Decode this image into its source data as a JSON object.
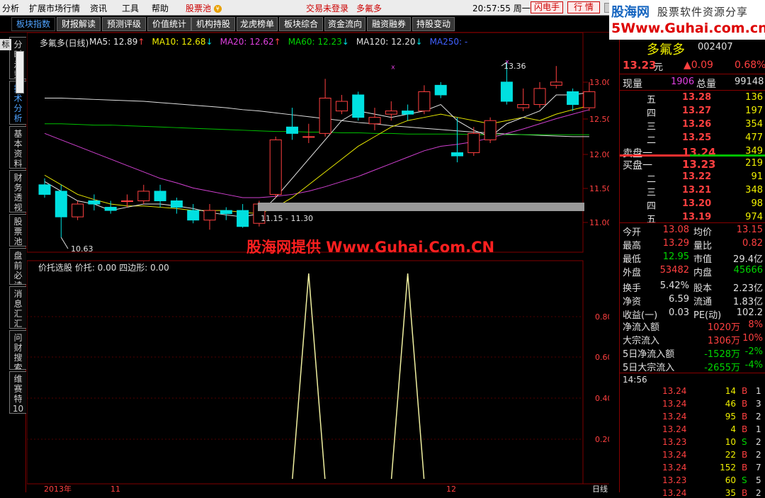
{
  "menu": {
    "items": [
      "分析",
      "扩展市场行情",
      "资讯",
      "工具",
      "帮助"
    ],
    "stock_pool": "股票池",
    "status": "交易未登录",
    "stock_name": "多氟多",
    "clock": "20:57:55 周一",
    "flash": "闪电手",
    "quote": "行  情",
    "pause": "∥"
  },
  "logo": {
    "a": "股海网",
    "b": "股票软件资源分享",
    "c": "5Www.Guhai.com.cn"
  },
  "tabs": [
    "板块指数",
    "财报解读",
    "预测评级",
    "价值统计",
    "机构持股",
    "龙虎榜单",
    "板块综合",
    "资金流向",
    "融资融券",
    "持股变动"
  ],
  "side_tag": "标",
  "side_tabs": [
    "分时走势",
    "技术分析",
    "基本资料",
    "财务透视",
    "股票池",
    "盘前必读",
    "消息汇汇",
    "问财搜索",
    "维赛特10"
  ],
  "chart": {
    "title": "多氟多(日线)",
    "ma": [
      {
        "label": "MA5: 12.89",
        "arrow": "↑",
        "color": "#e8e8e8",
        "acolor": "#ff4040"
      },
      {
        "label": "MA10: 12.68",
        "arrow": "↓",
        "color": "#f0f000",
        "acolor": "#00e0e0"
      },
      {
        "label": "MA20: 12.62",
        "arrow": "↑",
        "color": "#e040e0",
        "acolor": "#ff4040"
      },
      {
        "label": "MA60: 12.23",
        "arrow": "↓",
        "color": "#00d600",
        "acolor": "#00e0e0"
      },
      {
        "label": "MA120: 12.20",
        "arrow": "↓",
        "color": "#e0e0e0",
        "acolor": "#00e0e0"
      },
      {
        "label": "MA250: -",
        "arrow": "",
        "color": "#4060ff",
        "acolor": "#4060ff"
      }
    ],
    "high_label": "13.36",
    "low_label": "10.63",
    "range_label": "11.15 - 11.30",
    "watermark": "股海网提供 Www.Guhai.Com.CN",
    "ind_title": "价托选股  价托: 0.00  四边形: 0.00",
    "date_labels": [
      "2013年",
      "11",
      "12"
    ],
    "period": "日线",
    "price_ticks": [
      "13.00",
      "12.50",
      "12.00",
      "11.50",
      "11.00"
    ],
    "ind_ticks": [
      "0.80",
      "0.60",
      "0.40",
      "0.20"
    ]
  },
  "chart_data": {
    "type": "candlestick",
    "price_range": [
      10.4,
      13.6
    ],
    "candles": [
      {
        "o": 11.45,
        "c": 11.3,
        "h": 11.55,
        "l": 11.25
      },
      {
        "o": 11.35,
        "c": 10.95,
        "h": 11.45,
        "l": 10.63
      },
      {
        "o": 10.95,
        "c": 11.15,
        "h": 11.2,
        "l": 10.9
      },
      {
        "o": 11.2,
        "c": 11.15,
        "h": 11.3,
        "l": 11.05
      },
      {
        "o": 11.1,
        "c": 11.05,
        "h": 11.2,
        "l": 11.0
      },
      {
        "o": 11.2,
        "c": 11.2,
        "h": 11.3,
        "l": 11.1
      },
      {
        "o": 11.2,
        "c": 11.35,
        "h": 11.45,
        "l": 11.15
      },
      {
        "o": 11.35,
        "c": 11.2,
        "h": 11.45,
        "l": 11.1
      },
      {
        "o": 11.2,
        "c": 11.1,
        "h": 11.25,
        "l": 11.0
      },
      {
        "o": 11.05,
        "c": 10.9,
        "h": 11.15,
        "l": 10.85
      },
      {
        "o": 10.9,
        "c": 11.05,
        "h": 11.15,
        "l": 10.75
      },
      {
        "o": 11.05,
        "c": 11.0,
        "h": 11.1,
        "l": 10.9
      },
      {
        "o": 11.05,
        "c": 10.8,
        "h": 11.15,
        "l": 10.78
      },
      {
        "o": 10.85,
        "c": 11.15,
        "h": 11.2,
        "l": 10.8
      },
      {
        "o": 11.3,
        "c": 12.15,
        "h": 12.2,
        "l": 11.25
      },
      {
        "o": 12.35,
        "c": 12.25,
        "h": 12.65,
        "l": 12.15
      },
      {
        "o": 12.2,
        "c": 12.2,
        "h": 12.4,
        "l": 12.1
      },
      {
        "o": 12.25,
        "c": 12.8,
        "h": 13.1,
        "l": 12.2
      },
      {
        "o": 12.6,
        "c": 12.75,
        "h": 12.85,
        "l": 12.55
      },
      {
        "o": 12.85,
        "c": 12.5,
        "h": 12.9,
        "l": 12.45
      },
      {
        "o": 12.4,
        "c": 12.5,
        "h": 12.65,
        "l": 12.3
      },
      {
        "o": 12.55,
        "c": 12.6,
        "h": 12.75,
        "l": 12.45
      },
      {
        "o": 12.6,
        "c": 12.55,
        "h": 12.7,
        "l": 12.45
      },
      {
        "o": 12.6,
        "c": 12.9,
        "h": 13.0,
        "l": 12.55
      },
      {
        "o": 13.0,
        "c": 12.85,
        "h": 13.05,
        "l": 12.8
      },
      {
        "o": 11.95,
        "c": 11.9,
        "h": 12.5,
        "l": 11.8
      },
      {
        "o": 11.95,
        "c": 12.25,
        "h": 12.35,
        "l": 11.9
      },
      {
        "o": 12.15,
        "c": 12.45,
        "h": 12.5,
        "l": 12.1
      },
      {
        "o": 13.05,
        "c": 12.75,
        "h": 13.36,
        "l": 12.7
      },
      {
        "o": 12.65,
        "c": 12.7,
        "h": 12.95,
        "l": 12.6
      },
      {
        "o": 12.7,
        "c": 12.95,
        "h": 13.05,
        "l": 12.65
      },
      {
        "o": 13.0,
        "c": 13.05,
        "h": 13.3,
        "l": 12.95
      },
      {
        "o": 12.9,
        "c": 12.7,
        "h": 12.95,
        "l": 12.6
      },
      {
        "o": 12.65,
        "c": 12.9,
        "h": 13.05,
        "l": 12.6
      }
    ],
    "ma5": [
      11.5,
      11.35,
      11.2,
      11.15,
      11.05,
      11.1,
      11.15,
      11.15,
      11.12,
      11.08,
      11.02,
      10.98,
      10.95,
      11.0,
      11.25,
      11.55,
      11.85,
      12.15,
      12.45,
      12.6,
      12.55,
      12.5,
      12.55,
      12.6,
      12.7,
      12.45,
      12.3,
      12.2,
      12.4,
      12.5,
      12.6,
      12.85,
      12.85,
      12.89
    ],
    "ma10": [
      11.6,
      11.45,
      11.3,
      11.22,
      11.15,
      11.12,
      11.12,
      11.1,
      11.08,
      11.05,
      11.05,
      11.05,
      11.02,
      11.0,
      11.1,
      11.25,
      11.45,
      11.65,
      11.85,
      12.05,
      12.2,
      12.35,
      12.45,
      12.5,
      12.55,
      12.5,
      12.45,
      12.4,
      12.45,
      12.5,
      12.45,
      12.55,
      12.62,
      12.68
    ],
    "ma20": [
      12.25,
      12.15,
      12.05,
      11.95,
      11.85,
      11.75,
      11.65,
      11.55,
      11.48,
      11.4,
      11.35,
      11.3,
      11.25,
      11.25,
      11.27,
      11.3,
      11.35,
      11.42,
      11.5,
      11.58,
      11.68,
      11.78,
      11.88,
      11.98,
      12.05,
      12.08,
      12.12,
      12.18,
      12.25,
      12.32,
      12.4,
      12.48,
      12.55,
      12.62
    ],
    "ma60": [
      12.4,
      12.4,
      12.39,
      12.38,
      12.38,
      12.37,
      12.36,
      12.35,
      12.34,
      12.33,
      12.32,
      12.31,
      12.3,
      12.29,
      12.28,
      12.28,
      12.27,
      12.27,
      12.26,
      12.26,
      12.25,
      12.25,
      12.24,
      12.24,
      12.24,
      12.24,
      12.23,
      12.23,
      12.23,
      12.23,
      12.23,
      12.23,
      12.23,
      12.23
    ],
    "ma120": [
      12.8,
      12.8,
      12.79,
      12.78,
      12.77,
      12.76,
      12.75,
      12.73,
      12.71,
      12.69,
      12.67,
      12.65,
      12.62,
      12.6,
      12.57,
      12.54,
      12.51,
      12.48,
      12.45,
      12.42,
      12.4,
      12.37,
      12.35,
      12.33,
      12.31,
      12.29,
      12.27,
      12.26,
      12.24,
      12.23,
      12.22,
      12.21,
      12.2,
      12.2
    ],
    "indicator": [
      0,
      0,
      0,
      0,
      0,
      0,
      0,
      0,
      0,
      0,
      0,
      0,
      0,
      0,
      0,
      0,
      1,
      0,
      0,
      0,
      0,
      0,
      1,
      0,
      0,
      0,
      0,
      0,
      0,
      0,
      0,
      0,
      0,
      0
    ]
  },
  "quote": {
    "name": "多氟多",
    "code": "002407",
    "price": "13.23",
    "price_unit": "元",
    "change": "▲0.09",
    "pct": "0.68%",
    "now_label": "现量",
    "now_vol": "1906",
    "total_label": "总量",
    "total_vol": "99148",
    "sell": [
      [
        "五",
        "13.28",
        "136"
      ],
      [
        "四",
        "13.27",
        "197"
      ],
      [
        "三",
        "13.26",
        "354"
      ],
      [
        "二",
        "13.25",
        "477"
      ],
      [
        "卖盘一",
        "13.24",
        "349"
      ]
    ],
    "buy": [
      [
        "买盘一",
        "13.23",
        "219"
      ],
      [
        "二",
        "13.22",
        "91"
      ],
      [
        "三",
        "13.21",
        "348"
      ],
      [
        "四",
        "13.20",
        "98"
      ],
      [
        "五",
        "13.19",
        "974"
      ]
    ],
    "stats": [
      [
        "今开",
        "13.08",
        "均价",
        "13.15"
      ],
      [
        "最高",
        "13.29",
        "量比",
        "0.82"
      ],
      [
        "最低",
        "12.95",
        "市值",
        "29.4亿"
      ],
      [
        "外盘",
        "53482",
        "内盘",
        "45666"
      ],
      [
        "换手",
        "5.42%",
        "股本",
        "2.23亿"
      ],
      [
        "净资",
        "6.59",
        "流通",
        "1.83亿"
      ],
      [
        "收益(一)",
        "0.03",
        "PE(动)",
        "102.2"
      ]
    ],
    "flows": [
      [
        "净流入额",
        "1020万",
        "8%"
      ],
      [
        "大宗流入",
        "1306万",
        "10%"
      ],
      [
        "5日净流入额",
        "-1528万",
        "-2%"
      ],
      [
        "5日大宗流入",
        "-2655万",
        "-4%"
      ]
    ],
    "ticks_time": "14:56",
    "ticks": [
      [
        "13.24",
        "14",
        "B",
        "1"
      ],
      [
        "13.24",
        "46",
        "B",
        "3"
      ],
      [
        "13.24",
        "95",
        "B",
        "2"
      ],
      [
        "13.24",
        "4",
        "B",
        "1"
      ],
      [
        "13.23",
        "10",
        "S",
        "2"
      ],
      [
        "13.24",
        "22",
        "B",
        "2"
      ],
      [
        "13.24",
        "152",
        "B",
        "7"
      ],
      [
        "13.23",
        "60",
        "S",
        "5"
      ],
      [
        "13.24",
        "35",
        "B",
        "2"
      ]
    ]
  },
  "colors": {
    "up": "#ff4040",
    "down": "#00e0e0",
    "bg": "#000000",
    "grid": "#800000"
  }
}
